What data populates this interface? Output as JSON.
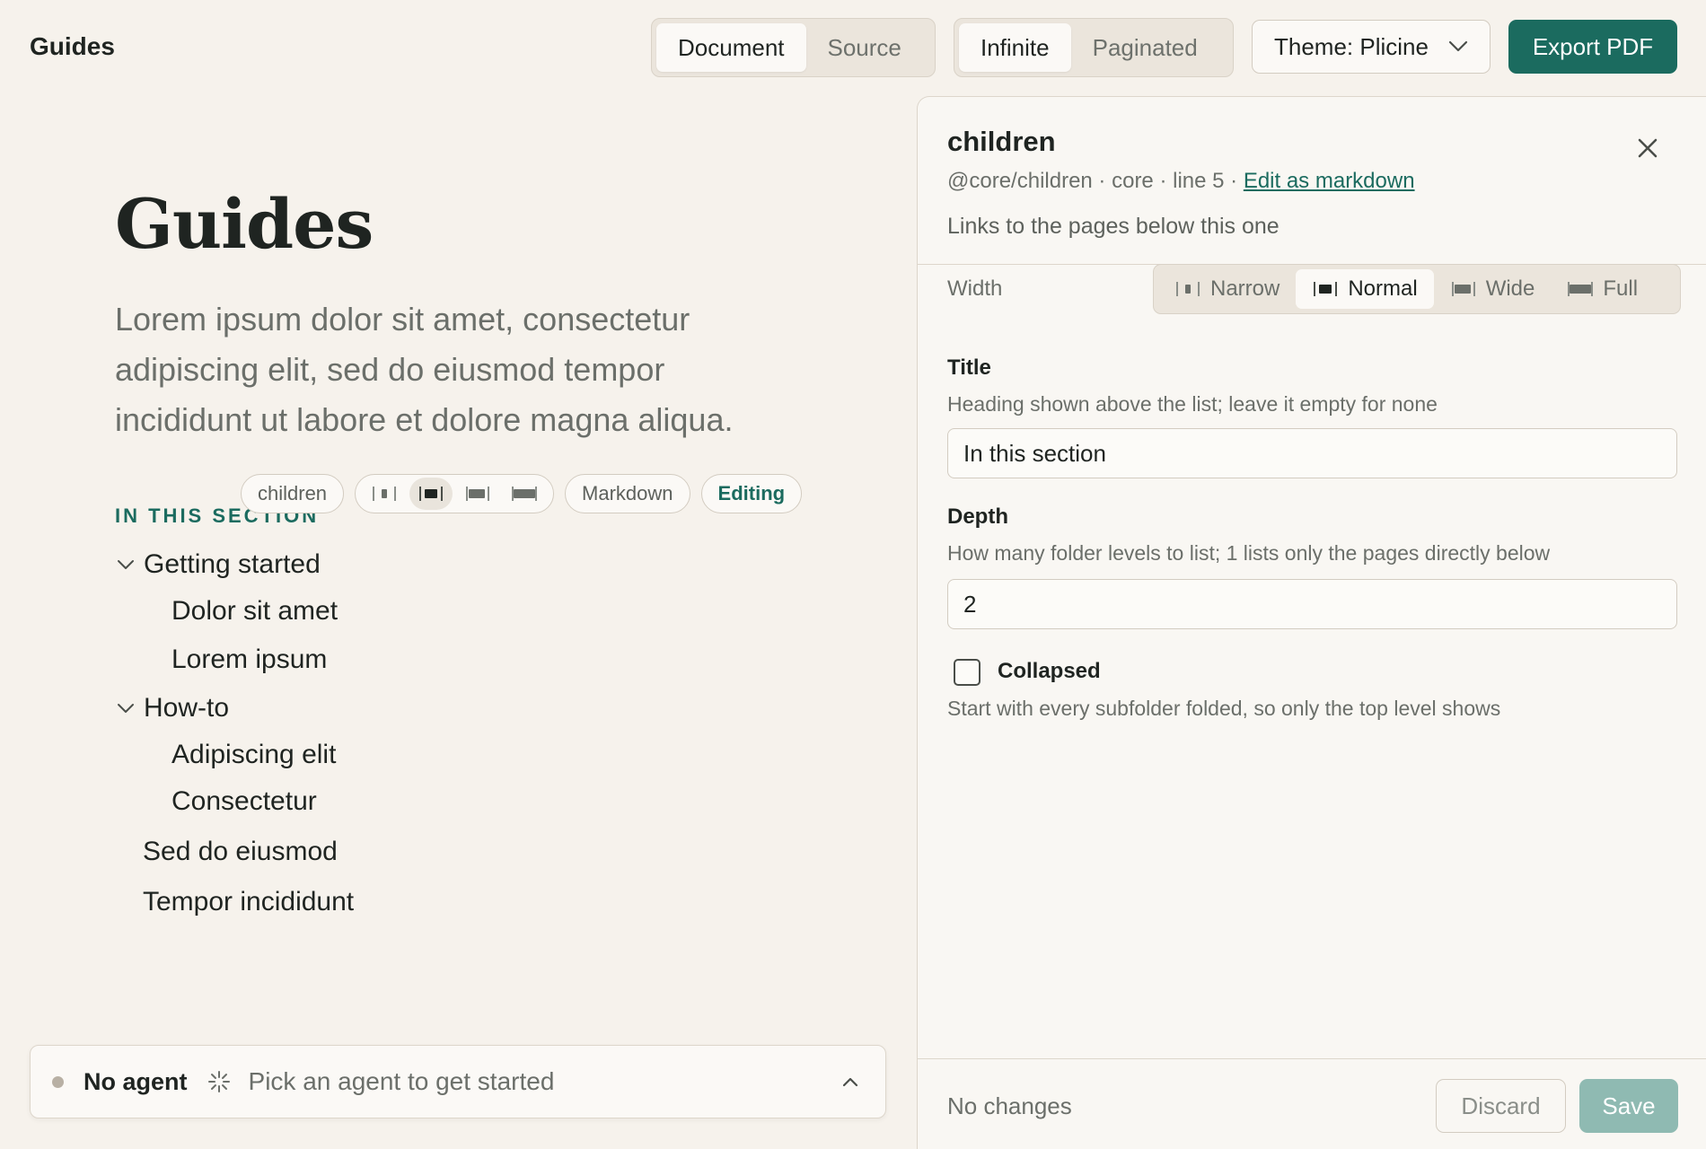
{
  "app": {
    "title": "Guides"
  },
  "toolbar": {
    "view_options": [
      "Document",
      "Source"
    ],
    "view_selected": "Document",
    "flow_options": [
      "Infinite",
      "Paginated"
    ],
    "flow_selected": "Infinite",
    "theme_label": "Theme: Plicine",
    "export_label": "Export PDF"
  },
  "document": {
    "title": "Guides",
    "lede": "Lorem ipsum dolor sit amet, consectetur adipiscing elit, sed do eiusmod tempor incididunt ut labore et dolore magna aliqua.",
    "block_toolbar": {
      "block_name": "children",
      "width_options": [
        "narrow",
        "normal",
        "wide",
        "full"
      ],
      "width_selected": "normal",
      "markdown_label": "Markdown",
      "editing_label": "Editing"
    },
    "section_label": "IN THIS SECTION",
    "tree": [
      {
        "label": "Getting started",
        "level": 0,
        "expandable": true,
        "expanded": true
      },
      {
        "label": "Dolor sit amet",
        "level": 1,
        "expandable": false
      },
      {
        "label": "Lorem ipsum",
        "level": 1,
        "expandable": false
      },
      {
        "label": "How-to",
        "level": 0,
        "expandable": true,
        "expanded": true
      },
      {
        "label": "Adipiscing elit",
        "level": 1,
        "expandable": false
      },
      {
        "label": "Consectetur",
        "level": 1,
        "expandable": false
      },
      {
        "label": "Sed do eiusmod",
        "level": 0,
        "expandable": false
      },
      {
        "label": "Tempor incididunt",
        "level": 0,
        "expandable": false
      }
    ]
  },
  "agent": {
    "name": "No agent",
    "hint": "Pick an agent to get started"
  },
  "panel": {
    "title": "children",
    "meta": "@core/children · core · line 5 · ",
    "meta_link": "Edit as markdown",
    "description": "Links to the pages below this one",
    "width_label": "Width",
    "width_options": [
      "Narrow",
      "Normal",
      "Wide",
      "Full"
    ],
    "width_selected": "Normal",
    "fields": {
      "title": {
        "label": "Title",
        "help": "Heading shown above the list; leave it empty for none",
        "value": "In this section"
      },
      "depth": {
        "label": "Depth",
        "help": "How many folder levels to list; 1 lists only the pages directly below",
        "value": "2"
      },
      "collapsed": {
        "label": "Collapsed",
        "help": "Start with every subfolder folded, so only the top level shows",
        "checked": false
      }
    },
    "status": "No changes",
    "discard_label": "Discard",
    "save_label": "Save"
  },
  "colors": {
    "background": "#f6f2ec",
    "accent": "#1b6b5f",
    "save_disabled": "#8fbab2"
  }
}
